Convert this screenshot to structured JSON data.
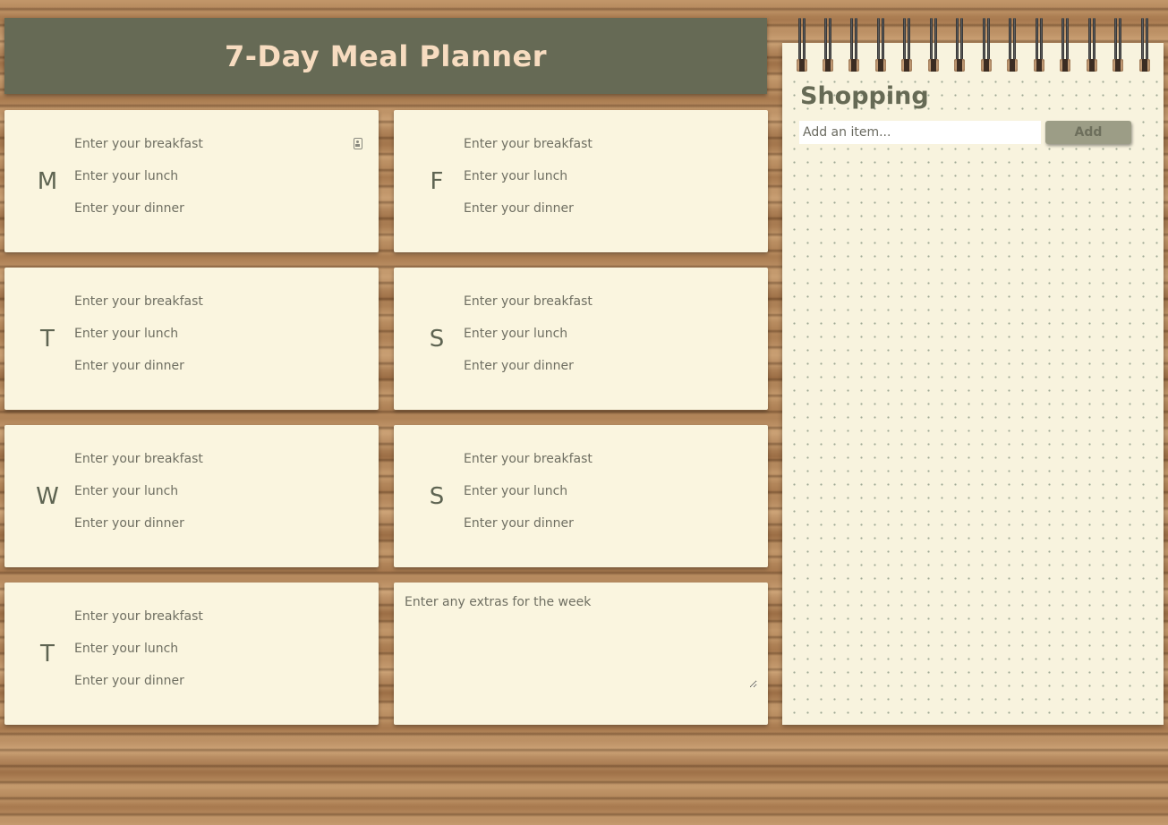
{
  "header": {
    "title": "7-Day Meal Planner"
  },
  "days": [
    {
      "letter": "M",
      "breakfast_placeholder": "Enter your breakfast",
      "lunch_placeholder": "Enter your lunch",
      "dinner_placeholder": "Enter your dinner"
    },
    {
      "letter": "T",
      "breakfast_placeholder": "Enter your breakfast",
      "lunch_placeholder": "Enter your lunch",
      "dinner_placeholder": "Enter your dinner"
    },
    {
      "letter": "W",
      "breakfast_placeholder": "Enter your breakfast",
      "lunch_placeholder": "Enter your lunch",
      "dinner_placeholder": "Enter your dinner"
    },
    {
      "letter": "T",
      "breakfast_placeholder": "Enter your breakfast",
      "lunch_placeholder": "Enter your lunch",
      "dinner_placeholder": "Enter your dinner"
    },
    {
      "letter": "F",
      "breakfast_placeholder": "Enter your breakfast",
      "lunch_placeholder": "Enter your lunch",
      "dinner_placeholder": "Enter your dinner"
    },
    {
      "letter": "S",
      "breakfast_placeholder": "Enter your breakfast",
      "lunch_placeholder": "Enter your lunch",
      "dinner_placeholder": "Enter your dinner"
    },
    {
      "letter": "S",
      "breakfast_placeholder": "Enter your breakfast",
      "lunch_placeholder": "Enter your lunch",
      "dinner_placeholder": "Enter your dinner"
    }
  ],
  "extras": {
    "placeholder": "Enter any extras for the week"
  },
  "shopping": {
    "title": "Shopping",
    "input_placeholder": "Add an item...",
    "add_label": "Add",
    "items": []
  },
  "icons": {
    "autofill": "contact-card-icon"
  },
  "colors": {
    "header_bg": "#666a55",
    "header_text": "#f7dcc0",
    "card_bg": "#faf5df",
    "day_letter": "#5e6452",
    "button_bg": "#9c9d86"
  }
}
